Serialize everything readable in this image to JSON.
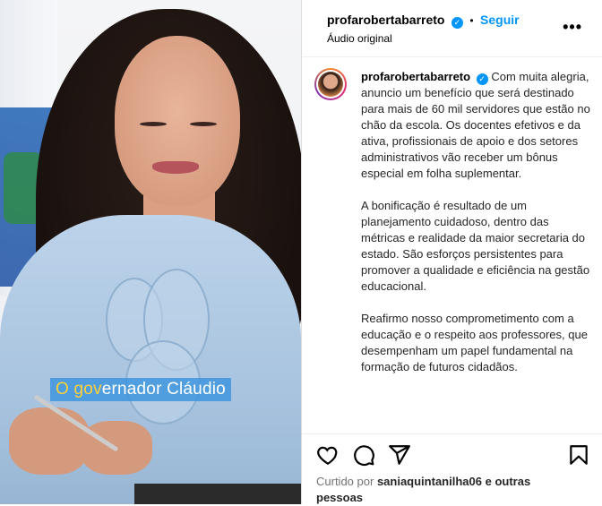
{
  "media": {
    "caption_highlight": "O gov",
    "caption_rest": "ernador Cláudio"
  },
  "header": {
    "username": "profarobertabarreto",
    "separator": "•",
    "follow_label": "Seguir",
    "audio_label": "Áudio original",
    "more_label": "•••"
  },
  "post": {
    "username": "profarobertabarreto",
    "paragraphs": [
      "Com muita alegria, anuncio um benefício que será destinado para mais de 60 mil servidores que estão no chão da escola. Os docentes efetivos e da ativa, profissionais de apoio e dos setores administrativos vão receber um bônus especial em folha suplementar.",
      "A bonificação é resultado de um planejamento cuidadoso, dentro das métricas e realidade da maior secretaria do estado. São esforços persistentes para promover a qualidade e eficiência na gestão educacional.",
      "Reafirmo nosso comprometimento com a educação e o respeito aos professores, que desempenham um papel fundamental na formação de futuros cidadãos."
    ]
  },
  "actions": {
    "liked_prefix": "Curtido por",
    "liked_user": "saniaquintanilha06",
    "liked_suffix": "e outras pessoas"
  },
  "icons": [
    "heart-icon",
    "comment-icon",
    "share-icon",
    "bookmark-icon",
    "verified-badge-icon",
    "more-options-icon"
  ],
  "colors": {
    "link": "#0095f6",
    "verified": "#0095f6",
    "caption_bg": "#4095de",
    "caption_highlight": "#ffd23a"
  }
}
